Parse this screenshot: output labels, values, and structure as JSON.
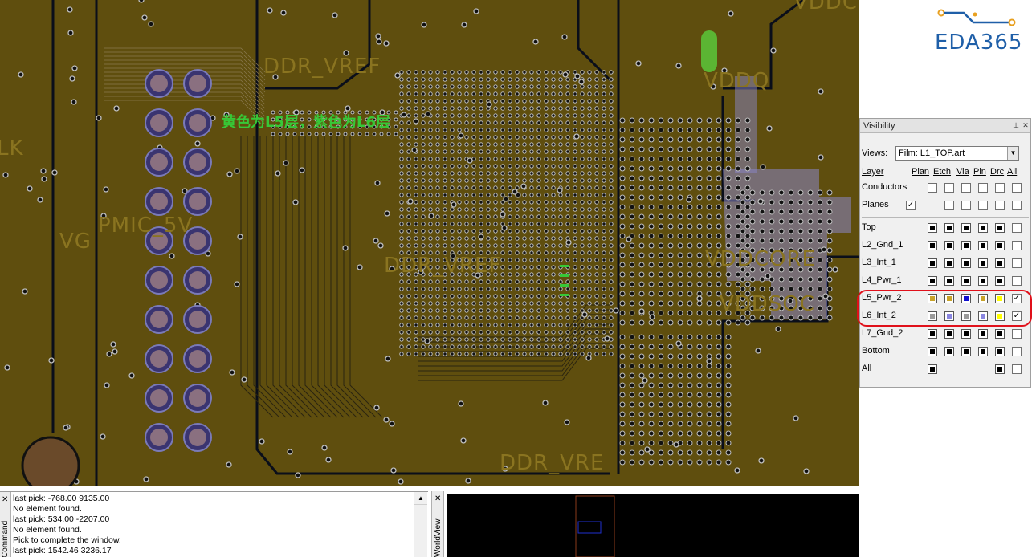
{
  "canvas": {
    "net_labels": {
      "ddr_vref_top": "DDR_VREF",
      "ddr_vref_mid": "DDR_VREF",
      "ddr_vref_bot": "DDR_VRE",
      "pmic_5v": "PMIC_5V",
      "vg": "VG",
      "vddcore": "VDDCORE",
      "vddsoc": "VDDSOC",
      "vddq": "VDDQ",
      "vddc_top": "VDDC",
      "lk": "LK"
    },
    "annotation": "黄色为L5层，紫色为L6层",
    "colors": {
      "board": "#5f4e0e",
      "copper_l5": "#c8a32a",
      "copper_l6": "#8a86c8",
      "via": "#bfbfbf",
      "trace": "#0a0e1a"
    }
  },
  "logo": {
    "text": "EDA365",
    "color": "#1f5fa8"
  },
  "visibility": {
    "title": "Visibility",
    "views_label": "Views:",
    "views_value": "Film: L1_TOP.art",
    "columns": {
      "layer": "Layer",
      "plan": "Plan",
      "etch": "Etch",
      "via": "Via",
      "pin": "Pin",
      "drc": "Drc",
      "all": "All"
    },
    "global_rows": [
      {
        "label": "Conductors",
        "plan": false,
        "etch": false,
        "via": false,
        "pin": false,
        "drc": false,
        "all": false
      },
      {
        "label": "Planes",
        "plan": true,
        "etch": false,
        "via": false,
        "pin": false,
        "drc": false,
        "all": false
      }
    ],
    "layers": [
      {
        "label": "Top",
        "colors": [
          "#000000",
          "#000000",
          "#000000",
          "#000000",
          "#000000"
        ],
        "all": false
      },
      {
        "label": "L2_Gnd_1",
        "colors": [
          "#000000",
          "#000000",
          "#000000",
          "#000000",
          "#000000"
        ],
        "all": false
      },
      {
        "label": "L3_Int_1",
        "colors": [
          "#000000",
          "#000000",
          "#000000",
          "#000000",
          "#000000"
        ],
        "all": false
      },
      {
        "label": "L4_Pwr_1",
        "colors": [
          "#000000",
          "#000000",
          "#000000",
          "#000000",
          "#000000"
        ],
        "all": false
      },
      {
        "label": "L5_Pwr_2",
        "colors": [
          "#c8a32a",
          "#c8a32a",
          "#1010d0",
          "#c8a32a",
          "#ffff00"
        ],
        "all": true
      },
      {
        "label": "L6_Int_2",
        "colors": [
          "#9a9a9a",
          "#8a86e0",
          "#9a9a9a",
          "#8a86e0",
          "#ffff00"
        ],
        "all": true
      },
      {
        "label": "L7_Gnd_2",
        "colors": [
          "#000000",
          "#000000",
          "#000000",
          "#000000",
          "#000000"
        ],
        "all": false
      },
      {
        "label": "Bottom",
        "colors": [
          "#000000",
          "#000000",
          "#000000",
          "#000000",
          "#000000"
        ],
        "all": false
      }
    ],
    "all_row": {
      "label": "All",
      "plan_color": "#000000",
      "drc_color": "#000000",
      "all": false
    }
  },
  "command": {
    "sidebar_label": "Command",
    "lines": [
      "last pick:  -768.00 9135.00",
      "No element found.",
      "last pick:  534.00 -2207.00",
      "No element found.",
      "Pick to complete the window.",
      "last pick:  1542.46 3236.17"
    ]
  },
  "worldview": {
    "sidebar_label": "WorldView"
  }
}
